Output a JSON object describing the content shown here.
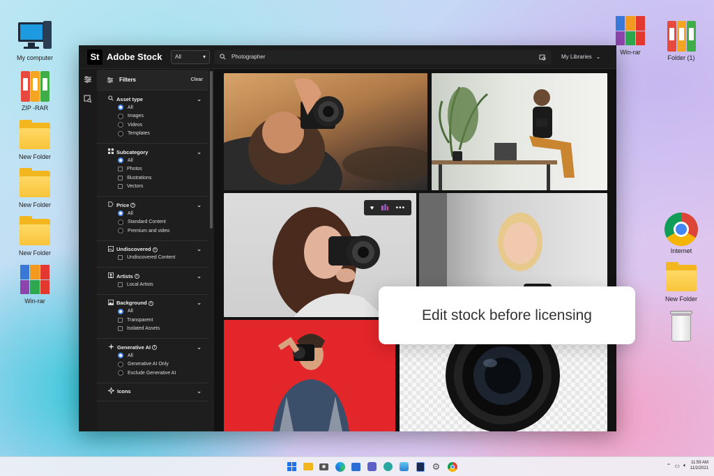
{
  "desktop": {
    "left_icons": [
      {
        "label": "My computer",
        "icon": "computer-icon"
      },
      {
        "label": "ZIP -RAR",
        "icon": "binders-icon"
      },
      {
        "label": "New Folder",
        "icon": "folder-icon"
      },
      {
        "label": "New Folder",
        "icon": "folder-icon"
      },
      {
        "label": "New Folder",
        "icon": "folder-icon"
      },
      {
        "label": "Win-rar",
        "icon": "winrar-icon"
      }
    ],
    "right_icons": [
      {
        "label": "Win-rar",
        "icon": "winrar-icon"
      },
      {
        "label": "Folder (1)",
        "icon": "binders-icon"
      },
      {
        "label": "Internet",
        "icon": "chrome-icon"
      },
      {
        "label": "New Folder",
        "icon": "folder-icon"
      },
      {
        "label": "",
        "icon": "recycle-bin-icon"
      }
    ]
  },
  "app": {
    "logo": "St",
    "brand": "Adobe Stock",
    "asset_select": "All",
    "search_value": "Photographer",
    "my_libraries": "My Libraries"
  },
  "filters": {
    "title": "Filters",
    "clear": "Clear",
    "sections": [
      {
        "title": "Asset type",
        "icon": "search-icon",
        "info": false,
        "options": [
          {
            "label": "All",
            "type": "radio",
            "on": true
          },
          {
            "label": "Images",
            "type": "radio",
            "on": false
          },
          {
            "label": "Videos",
            "type": "radio",
            "on": false
          },
          {
            "label": "Templates",
            "type": "radio",
            "on": false
          }
        ]
      },
      {
        "title": "Subcategory",
        "icon": "grid-icon",
        "info": false,
        "options": [
          {
            "label": "All",
            "type": "radio",
            "on": true
          },
          {
            "label": "Photos",
            "type": "check",
            "on": false
          },
          {
            "label": "Illustrations",
            "type": "check",
            "on": false
          },
          {
            "label": "Vectors",
            "type": "check",
            "on": false
          }
        ]
      },
      {
        "title": "Price",
        "icon": "tag-icon",
        "info": true,
        "options": [
          {
            "label": "All",
            "type": "radio",
            "on": true
          },
          {
            "label": "Standard Content",
            "type": "radio",
            "on": false
          },
          {
            "label": "Premium and video",
            "type": "radio",
            "on": false
          }
        ]
      },
      {
        "title": "Undiscovered",
        "icon": "image-icon",
        "info": true,
        "options": [
          {
            "label": "Undiscovered Content",
            "type": "check",
            "on": false
          }
        ]
      },
      {
        "title": "Artists",
        "icon": "person-icon",
        "info": true,
        "options": [
          {
            "label": "Local Artists",
            "type": "check",
            "on": false
          }
        ]
      },
      {
        "title": "Background",
        "icon": "background-icon",
        "info": true,
        "options": [
          {
            "label": "All",
            "type": "radio",
            "on": true
          },
          {
            "label": "Transparent",
            "type": "check",
            "on": false
          },
          {
            "label": "Isolated Assets",
            "type": "check",
            "on": false
          }
        ]
      },
      {
        "title": "Generative AI",
        "icon": "sparkle-icon",
        "info": true,
        "options": [
          {
            "label": "All",
            "type": "radio",
            "on": true
          },
          {
            "label": "Generative AI Only",
            "type": "radio",
            "on": false
          },
          {
            "label": "Exclude Generative AI",
            "type": "radio",
            "on": false
          }
        ]
      },
      {
        "title": "Icons",
        "icon": "icons-icon",
        "info": false,
        "options": []
      }
    ]
  },
  "callout": "Edit stock before licensing",
  "clock": {
    "time": "11:59 AM",
    "date": "11/2/2021"
  },
  "colors": {
    "accent": "#4b8df8",
    "dark_bg": "#121212",
    "panel_bg": "#1e1e1e"
  }
}
